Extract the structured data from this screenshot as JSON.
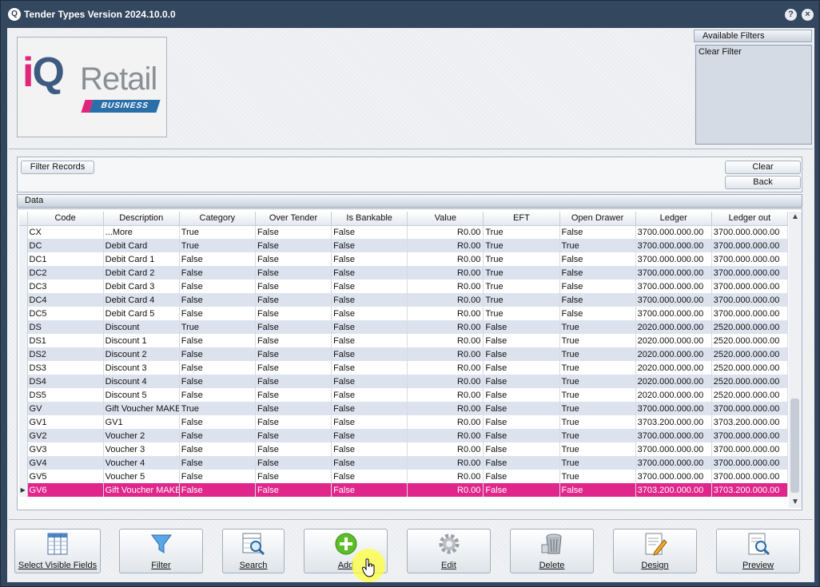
{
  "window": {
    "title": "Tender Types Version 2024.10.0.0",
    "help_glyph": "?",
    "close_glyph": "×"
  },
  "logo": {
    "i": "i",
    "q": "Q",
    "retail": "Retail",
    "band": "BUSINESS"
  },
  "filters": {
    "header": "Available Filters",
    "items": [
      "Clear Filter"
    ]
  },
  "filter_area": {
    "filter_records_label": "Filter Records",
    "clear_label": "Clear",
    "back_label": "Back"
  },
  "data_section": {
    "header": "Data"
  },
  "grid": {
    "columns": [
      "Code",
      "Description",
      "Category",
      "Over Tender",
      "Is Bankable",
      "Value",
      "EFT",
      "Open Drawer",
      "Ledger",
      "Ledger out"
    ],
    "rows": [
      [
        "CX",
        "...More",
        "True",
        "False",
        "False",
        "R0.00",
        "True",
        "False",
        "3700.000.000.00",
        "3700.000.000.00"
      ],
      [
        "DC",
        "Debit Card",
        "True",
        "False",
        "False",
        "R0.00",
        "True",
        "True",
        "3700.000.000.00",
        "3700.000.000.00"
      ],
      [
        "DC1",
        "Debit Card 1",
        "False",
        "False",
        "False",
        "R0.00",
        "True",
        "False",
        "3700.000.000.00",
        "3700.000.000.00"
      ],
      [
        "DC2",
        "Debit Card 2",
        "False",
        "False",
        "False",
        "R0.00",
        "True",
        "False",
        "3700.000.000.00",
        "3700.000.000.00"
      ],
      [
        "DC3",
        "Debit Card 3",
        "False",
        "False",
        "False",
        "R0.00",
        "True",
        "False",
        "3700.000.000.00",
        "3700.000.000.00"
      ],
      [
        "DC4",
        "Debit Card 4",
        "False",
        "False",
        "False",
        "R0.00",
        "True",
        "False",
        "3700.000.000.00",
        "3700.000.000.00"
      ],
      [
        "DC5",
        "Debit Card 5",
        "False",
        "False",
        "False",
        "R0.00",
        "True",
        "False",
        "3700.000.000.00",
        "3700.000.000.00"
      ],
      [
        "DS",
        "Discount",
        "True",
        "False",
        "False",
        "R0.00",
        "False",
        "True",
        "2020.000.000.00",
        "2520.000.000.00"
      ],
      [
        "DS1",
        "Discount 1",
        "False",
        "False",
        "False",
        "R0.00",
        "False",
        "True",
        "2020.000.000.00",
        "2520.000.000.00"
      ],
      [
        "DS2",
        "Discount 2",
        "False",
        "False",
        "False",
        "R0.00",
        "False",
        "True",
        "2020.000.000.00",
        "2520.000.000.00"
      ],
      [
        "DS3",
        "Discount 3",
        "False",
        "False",
        "False",
        "R0.00",
        "False",
        "True",
        "2020.000.000.00",
        "2520.000.000.00"
      ],
      [
        "DS4",
        "Discount 4",
        "False",
        "False",
        "False",
        "R0.00",
        "False",
        "True",
        "2020.000.000.00",
        "2520.000.000.00"
      ],
      [
        "DS5",
        "Discount 5",
        "False",
        "False",
        "False",
        "R0.00",
        "False",
        "True",
        "2020.000.000.00",
        "2520.000.000.00"
      ],
      [
        "GV",
        "Gift Voucher MAKE",
        "True",
        "False",
        "False",
        "R0.00",
        "False",
        "True",
        "3700.000.000.00",
        "3700.000.000.00"
      ],
      [
        "GV1",
        "GV1",
        "False",
        "False",
        "False",
        "R0.00",
        "False",
        "True",
        "3703.200.000.00",
        "3703.200.000.00"
      ],
      [
        "GV2",
        "Voucher 2",
        "False",
        "False",
        "False",
        "R0.00",
        "False",
        "True",
        "3700.000.000.00",
        "3700.000.000.00"
      ],
      [
        "GV3",
        "Voucher 3",
        "False",
        "False",
        "False",
        "R0.00",
        "False",
        "True",
        "3700.000.000.00",
        "3700.000.000.00"
      ],
      [
        "GV4",
        "Voucher 4",
        "False",
        "False",
        "False",
        "R0.00",
        "False",
        "True",
        "3700.000.000.00",
        "3700.000.000.00"
      ],
      [
        "GV5",
        "Voucher 5",
        "False",
        "False",
        "False",
        "R0.00",
        "False",
        "True",
        "3700.000.000.00",
        "3700.000.000.00"
      ],
      [
        "GV6",
        "Gift Voucher MAKE",
        "False",
        "False",
        "False",
        "R0.00",
        "False",
        "False",
        "3703.200.000.00",
        "3703.200.000.00"
      ]
    ],
    "selected_row": 19,
    "row_indicator": "▶",
    "scroll_up": "▲",
    "scroll_down": "▼"
  },
  "toolbar": [
    {
      "name": "select-visible-fields-button",
      "label": "Select Visible Fields",
      "icon": "columns-icon"
    },
    {
      "name": "filter-button",
      "label": "Filter",
      "icon": "funnel-icon"
    },
    {
      "name": "search-button",
      "label": "Search",
      "icon": "magnifier-table-icon"
    },
    {
      "name": "add-button",
      "label": "Add",
      "icon": "plus-circle-icon"
    },
    {
      "name": "edit-button",
      "label": "Edit",
      "icon": "gear-icon"
    },
    {
      "name": "delete-button",
      "label": "Delete",
      "icon": "trash-icon"
    },
    {
      "name": "design-button",
      "label": "Design",
      "icon": "pencil-document-icon"
    },
    {
      "name": "preview-button",
      "label": "Preview",
      "icon": "document-preview-icon"
    }
  ],
  "colors": {
    "selected_row": "#e0268a",
    "title_bar": "#33475e",
    "brand_pink": "#e2257a",
    "brand_blue": "#3d5a80"
  }
}
